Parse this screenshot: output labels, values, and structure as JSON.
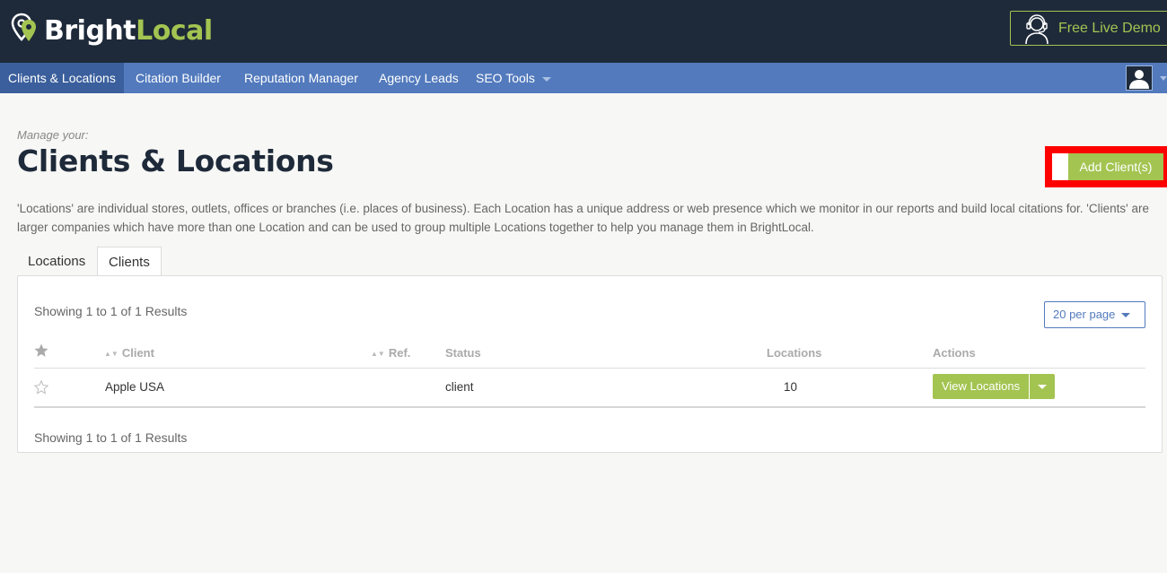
{
  "header": {
    "logo": {
      "part1": "Bright",
      "part2": "Local",
      "icon": "map-pin-icon"
    },
    "demo_button": {
      "label": "Free Live Demo",
      "icon": "headset-icon"
    }
  },
  "nav": {
    "items": [
      {
        "label": "Clients & Locations",
        "active": true
      },
      {
        "label": "Citation Builder"
      },
      {
        "label": "Reputation Manager"
      },
      {
        "label": "Agency Leads"
      },
      {
        "label": "SEO Tools",
        "has_dropdown": true
      }
    ],
    "user_icon": "user-icon"
  },
  "page": {
    "manage_label": "Manage your:",
    "title": "Clients & Locations",
    "add_button": "Add Client(s)",
    "description": "'Locations' are individual stores, outlets, offices or branches (i.e. places of business). Each Location has a unique address or web presence which we monitor in our reports and build local citations for. 'Clients' are larger companies which have more than one Location and can be used to group multiple Locations together to help you manage them in BrightLocal."
  },
  "tabs": [
    {
      "label": "Locations"
    },
    {
      "label": "Clients",
      "active": true
    }
  ],
  "table": {
    "showing_top": "Showing 1 to 1 of 1 Results",
    "showing_bottom": "Showing 1 to 1 of 1 Results",
    "per_page": "20 per page",
    "columns": {
      "client": "Client",
      "ref": "Ref.",
      "status": "Status",
      "locations": "Locations",
      "actions": "Actions"
    },
    "rows": [
      {
        "client": "Apple USA",
        "ref": "",
        "status": "client",
        "locations": "10",
        "action": "View Locations"
      }
    ]
  },
  "colors": {
    "header_bg": "#1e2a3a",
    "nav_bg": "#527abd",
    "accent_green": "#a3c451",
    "highlight_red": "#ff0000"
  }
}
